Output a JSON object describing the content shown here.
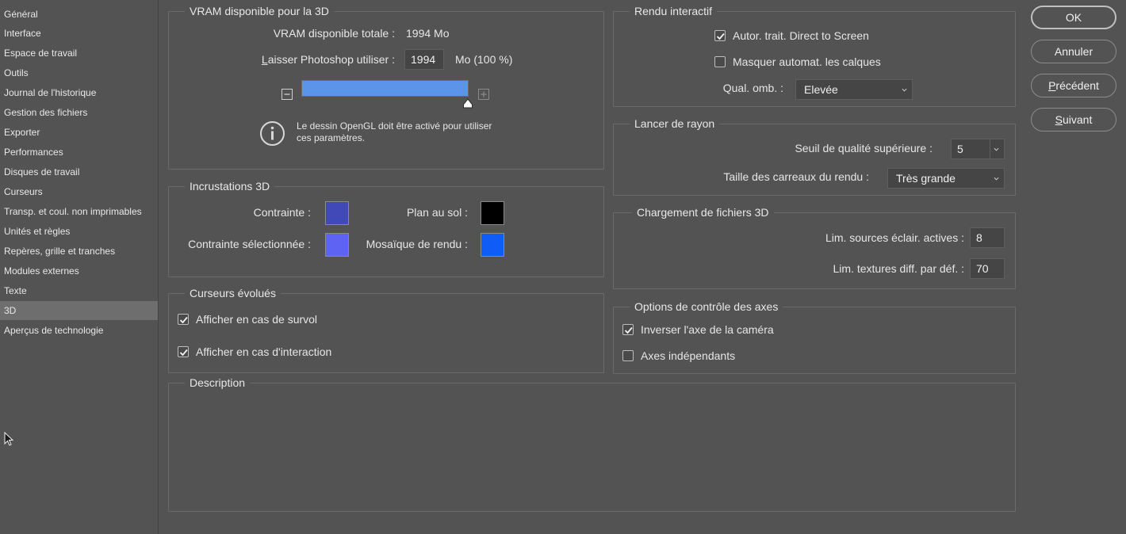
{
  "sidebar": {
    "items": [
      {
        "label": "Général"
      },
      {
        "label": "Interface"
      },
      {
        "label": "Espace de travail"
      },
      {
        "label": "Outils"
      },
      {
        "label": "Journal de l'historique"
      },
      {
        "label": "Gestion des fichiers"
      },
      {
        "label": "Exporter"
      },
      {
        "label": "Performances"
      },
      {
        "label": "Disques de travail"
      },
      {
        "label": "Curseurs"
      },
      {
        "label": "Transp. et coul. non imprimables"
      },
      {
        "label": "Unités et règles"
      },
      {
        "label": "Repères, grille et tranches"
      },
      {
        "label": "Modules externes"
      },
      {
        "label": "Texte"
      },
      {
        "label": "3D",
        "selected": true
      },
      {
        "label": "Aperçus de technologie"
      }
    ]
  },
  "vram": {
    "title": "VRAM disponible pour la 3D",
    "total_label": "VRAM disponible totale :",
    "total_value": "1994 Mo",
    "allow_label_first": "L",
    "allow_label_rest": "aisser Photoshop utiliser :",
    "allow_value": "1994",
    "allow_unit": "Mo (100 %)",
    "slider_fraction": 1.0,
    "info_text_1": "Le dessin OpenGL doit être activé pour utiliser",
    "info_text_2": "ces paramètres.",
    "slider_color": "#5b94e8"
  },
  "overlays": {
    "title": "Incrustations 3D",
    "constraint_label": "Contrainte :",
    "constraint_color": "#4149b8",
    "ground_label": "Plan au sol :",
    "ground_color": "#000000",
    "selected_constraint_label": "Contrainte sélectionnée :",
    "selected_constraint_color": "#5f63f4",
    "render_tiles_label": "Mosaïque de rendu :",
    "render_tiles_color": "#0f5cf6"
  },
  "cursors": {
    "title": "Curseurs évolués",
    "hover_label": "Afficher en cas de survol",
    "hover_checked": true,
    "interact_label": "Afficher en cas d'interaction",
    "interact_checked": true
  },
  "description": {
    "title": "Description"
  },
  "interactive": {
    "title": "Rendu interactif",
    "direct_label": "Autor. trait. Direct to Screen",
    "direct_checked": true,
    "hide_layers_label": "Masquer automat. les calques",
    "hide_layers_checked": false,
    "shadow_label": "Qual. omb. :",
    "shadow_value": "Elevée"
  },
  "raytrace": {
    "title": "Lancer de rayon",
    "threshold_label": "Seuil de qualité supérieure :",
    "threshold_value": "5",
    "tile_label": "Taille des carreaux du rendu :",
    "tile_value": "Très grande"
  },
  "loading": {
    "title": "Chargement de fichiers 3D",
    "lights_label": "Lim. sources éclair. actives :",
    "lights_value": "8",
    "textures_label": "Lim. textures diff. par déf. :",
    "textures_value": "70"
  },
  "axes": {
    "title": "Options de contrôle des axes",
    "invert_label": "Inverser l'axe de la caméra",
    "invert_checked": true,
    "independent_label": "Axes indépendants",
    "independent_checked": false
  },
  "buttons": {
    "ok": "OK",
    "cancel": "Annuler",
    "prev_first": "P",
    "prev_rest": "récédent",
    "next_first": "S",
    "next_rest": "uivant"
  },
  "icons": {
    "info": "info-circle-icon",
    "minus": "minus-box-icon",
    "plus": "plus-box-icon",
    "cursor": "mouse-pointer-icon",
    "check": "checkmark-icon",
    "chevron": "chevron-down-icon"
  }
}
